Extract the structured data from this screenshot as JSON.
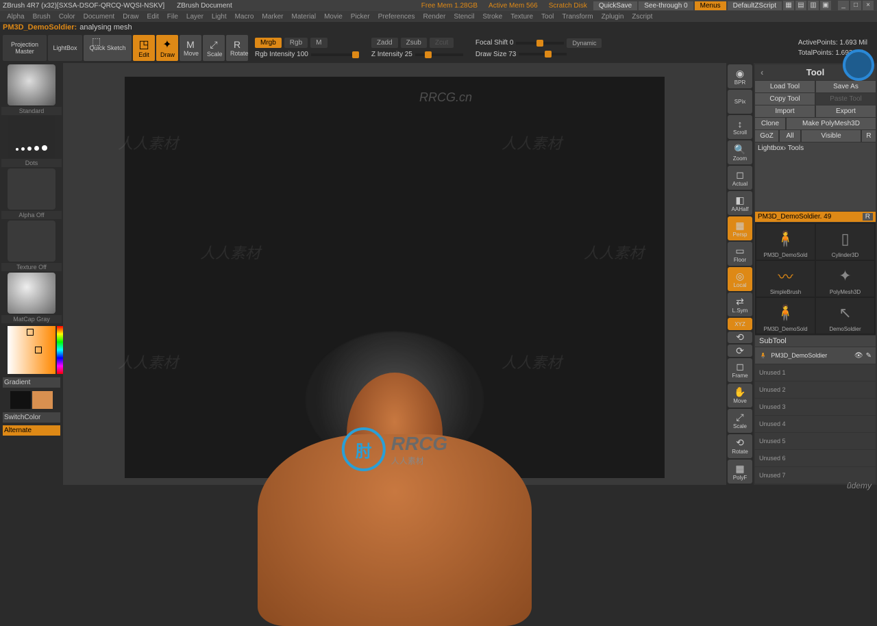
{
  "titlebar": {
    "app": "ZBrush 4R7 (x32)[SXSA-DSOF-QRCQ-WQSI-NSKV]",
    "doc": "ZBrush Document",
    "free_mem": "Free Mem 1.28GB",
    "active_mem": "Active Mem 566",
    "scratch": "Scratch Disk",
    "quicksave": "QuickSave",
    "seethrough": "See-through  0",
    "menus": "Menus",
    "defaultzscript": "DefaultZScript"
  },
  "menus": [
    "Alpha",
    "Brush",
    "Color",
    "Document",
    "Draw",
    "Edit",
    "File",
    "Layer",
    "Light",
    "Macro",
    "Marker",
    "Material",
    "Movie",
    "Picker",
    "Preferences",
    "Render",
    "Stencil",
    "Stroke",
    "Texture",
    "Tool",
    "Transform",
    "Zplugin",
    "Zscript"
  ],
  "status": {
    "doc": "PM3D_DemoSoldier:",
    "msg": "analysing mesh"
  },
  "toolbar": {
    "projection": "Projection Master",
    "lightbox": "LightBox",
    "quicksketch": "Quick Sketch",
    "edit": "Edit",
    "draw": "Draw",
    "move": "Move",
    "scale": "Scale",
    "rotate": "Rotate",
    "mrgb": "Mrgb",
    "rgb": "Rgb",
    "m": "M",
    "zadd": "Zadd",
    "zsub": "Zsub",
    "zcut": "Zcut",
    "rgb_intensity": "Rgb Intensity 100",
    "z_intensity": "Z Intensity 25",
    "focal_shift": "Focal Shift 0",
    "draw_size": "Draw Size 73",
    "dynamic": "Dynamic",
    "active_points": "ActivePoints: 1.693 Mil",
    "total_points": "TotalPoints: 1.693 Mil"
  },
  "left": {
    "standard": "Standard",
    "dots": "Dots",
    "alpha_off": "Alpha Off",
    "texture_off": "Texture Off",
    "matcap": "MatCap Gray",
    "gradient": "Gradient",
    "switchcolor": "SwitchColor",
    "alternate": "Alternate"
  },
  "right_strip": [
    "BPR",
    "SPix",
    "Scroll",
    "Zoom",
    "Actual",
    "AAHalf",
    "Persp",
    "Floor",
    "Local",
    "L.Sym",
    "XYZ",
    "",
    "",
    "Frame",
    "Move",
    "Scale",
    "Rotate",
    "PolyF"
  ],
  "tool_panel": {
    "header": "Tool",
    "load": "Load Tool",
    "save": "Save As",
    "copy": "Copy Tool",
    "paste": "Paste Tool",
    "import": "Import",
    "export": "Export",
    "clone": "Clone",
    "make_polymesh": "Make PolyMesh3D",
    "goz": "GoZ",
    "all": "All",
    "visible": "Visible",
    "r": "R",
    "lightbox_tools": "Lightbox› Tools",
    "tool_name": "PM3D_DemoSoldier. 49",
    "thumbs": [
      {
        "label": "PM3D_DemoSold"
      },
      {
        "label": "Cylinder3D"
      },
      {
        "label": "SimpleBrush"
      },
      {
        "label": "PolyMesh3D"
      },
      {
        "label": "PM3D_DemoSold"
      },
      {
        "label": "DemoSoldier"
      }
    ],
    "subtool_header": "SubTool",
    "subtool_active": "PM3D_DemoSoldier",
    "subtool_slots": [
      "Unused 1",
      "Unused 2",
      "Unused 3",
      "Unused 4",
      "Unused 5",
      "Unused 6",
      "Unused 7"
    ]
  },
  "branding": {
    "rrcg": "RRCG",
    "rrcg_sub": "人人素材",
    "site": "RRCG.cn",
    "udemy": "ûdemy"
  }
}
